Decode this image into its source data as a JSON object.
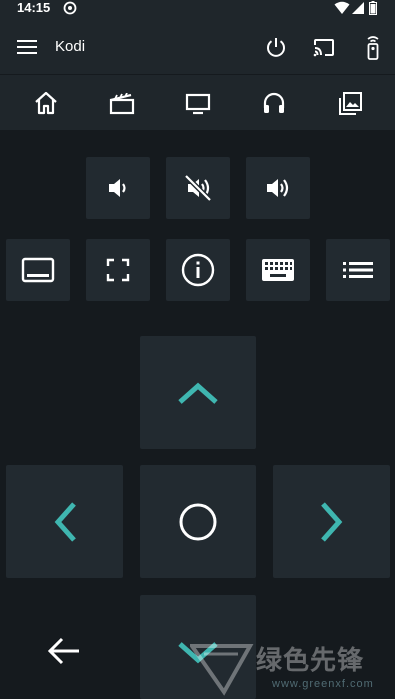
{
  "status_bar": {
    "time": "14:15"
  },
  "app_bar": {
    "title": "Kodi"
  },
  "watermark": {
    "brand": "绿色先锋",
    "url": "www.greenxf.com"
  },
  "colors": {
    "accent": "#3fb6b0",
    "button": "#222a30",
    "bar": "#1f262b",
    "background": "#151a1e"
  },
  "icons": {
    "menu": "menu-icon",
    "power": "power-icon",
    "cast": "cast-icon",
    "remote": "remote-icon",
    "home": "home-icon",
    "movies": "movies-icon",
    "tv": "tv-icon",
    "music": "headphones-icon",
    "pictures": "pictures-icon"
  }
}
